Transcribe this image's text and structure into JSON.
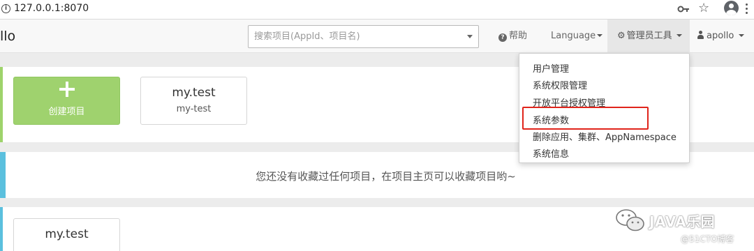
{
  "browser": {
    "url": "127.0.0.1:8070",
    "icons": [
      "info-icon",
      "key-icon",
      "star-icon",
      "account-icon",
      "kebab-menu-icon"
    ]
  },
  "navbar": {
    "brand": "llo",
    "search": {
      "placeholder": "搜索项目(AppId、项目名)",
      "value": ""
    },
    "help_label": "帮助",
    "language_label": "Language",
    "admin_tools_label": "管理员工具",
    "user_label": "apollo"
  },
  "admin_menu": {
    "items": [
      {
        "label": "用户管理"
      },
      {
        "label": "系统权限管理"
      },
      {
        "label": "开放平台授权管理"
      },
      {
        "label": "系统参数",
        "highlighted": true
      },
      {
        "label": "删除应用、集群、AppNamespace"
      },
      {
        "label": "系统信息"
      }
    ],
    "highlight_color": "#e0241b"
  },
  "projects": {
    "create_label": "创建项目",
    "cards": [
      {
        "name": "my.test",
        "app_id": "my-test"
      }
    ]
  },
  "favorites": {
    "empty_message": "您还没有收藏过任何项目，在项目主页可以收藏项目哟~"
  },
  "recent": {
    "cards": [
      {
        "name": "my.test"
      }
    ]
  },
  "watermark": {
    "title": "JAVA乐园",
    "source": "@51CTO博客"
  },
  "colors": {
    "create_green": "#9fd26e",
    "accent_blue": "#5bc0de",
    "accent_green": "#9ed36b"
  }
}
